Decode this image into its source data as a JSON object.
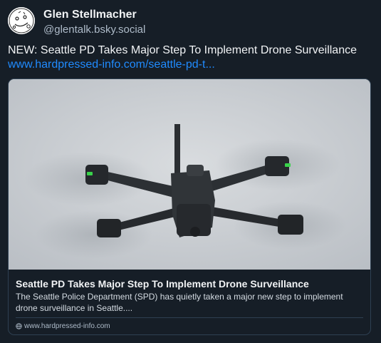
{
  "author": {
    "display_name": "Glen Stellmacher",
    "handle": "@glentalk.bsky.social",
    "avatar_icon": "doodle-face-icon"
  },
  "post": {
    "text": "NEW: Seattle PD Takes Major Step To Implement Drone Surveillance",
    "link_text": "www.hardpressed-info.com/seattle-pd-t..."
  },
  "link_card": {
    "image_subject": "quadcopter-drone-photo",
    "title": "Seattle PD Takes Major Step To Implement Drone Surveillance",
    "description": "The Seattle Police Department (SPD) has quietly taken a major new step to implement drone surveillance in Seattle....",
    "domain": "www.hardpressed-info.com",
    "domain_icon": "globe-icon"
  },
  "colors": {
    "background": "#161e27",
    "text_primary": "#f1f3f5",
    "text_secondary": "#aebbc9",
    "link": "#208bfe",
    "border": "#2e4052"
  }
}
